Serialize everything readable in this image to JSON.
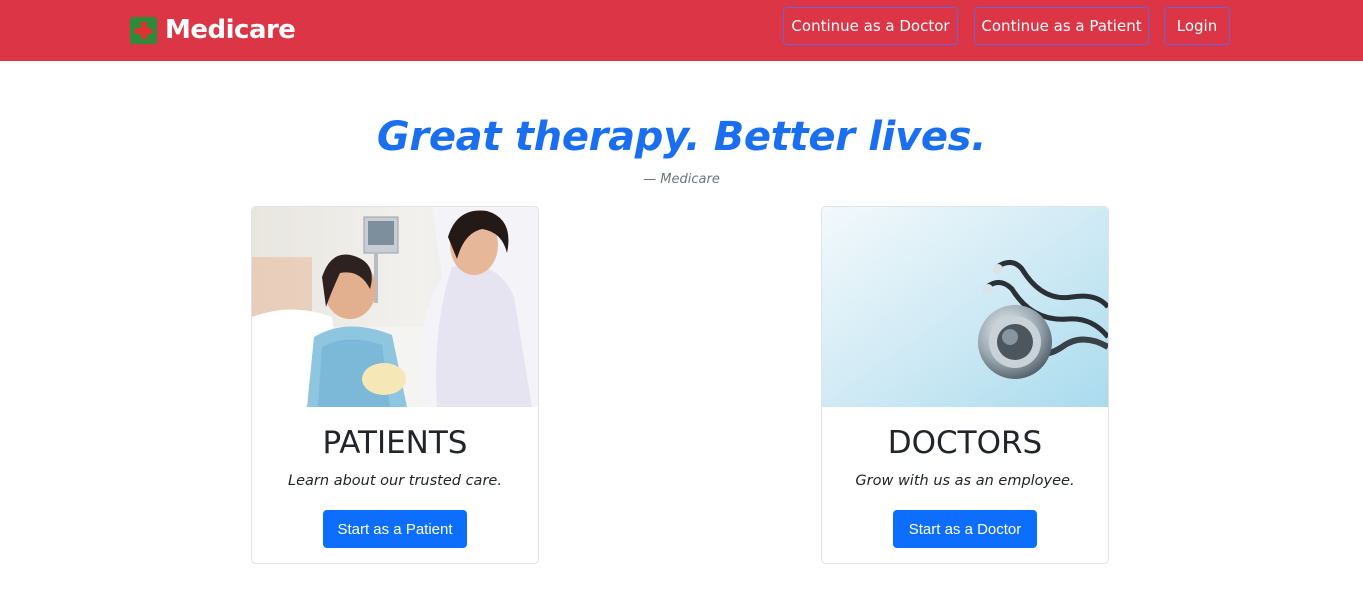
{
  "navbar": {
    "brand_icon": "medical-cross-icon",
    "brand_name": "Medicare",
    "background_color": "#dc3545",
    "links": {
      "doctor": "Continue as a Doctor",
      "patient": "Continue as a Patient",
      "login": "Login"
    }
  },
  "hero": {
    "headline": "Great therapy. Better lives.",
    "attribution": "— Medicare",
    "headline_color": "#1a6ff0"
  },
  "cards": {
    "patients": {
      "image": "patient-with-doctor-photo",
      "title": "PATIENTS",
      "text": "Learn about our trusted care.",
      "button": "Start as a Patient"
    },
    "doctors": {
      "image": "stethoscope-photo",
      "title": "DOCTORS",
      "text": "Grow with us as an employee.",
      "button": "Start as a Doctor"
    }
  },
  "button_color": "#0d6efd"
}
